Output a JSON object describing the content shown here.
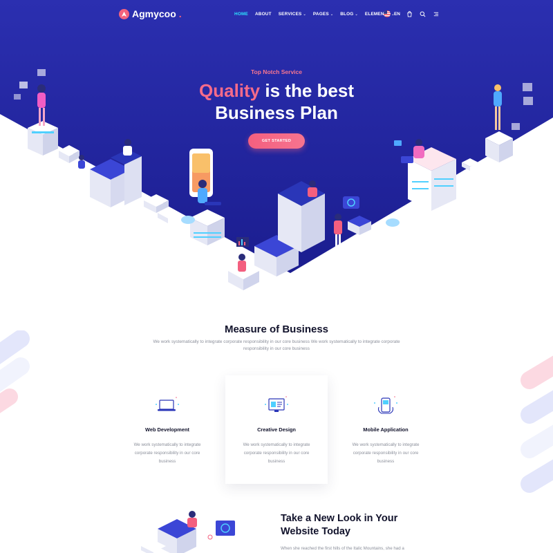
{
  "brand": {
    "name": "Agmycoo",
    "dot": ".",
    "accent": "#f4637e"
  },
  "nav": {
    "items": [
      {
        "label": "HOME",
        "active": true,
        "caret": false
      },
      {
        "label": "ABOUT",
        "active": false,
        "caret": false
      },
      {
        "label": "SERVICES",
        "active": false,
        "caret": true
      },
      {
        "label": "PAGES",
        "active": false,
        "caret": true
      },
      {
        "label": "BLOG",
        "active": false,
        "caret": true
      },
      {
        "label": "ELEMENTS",
        "active": false,
        "caret": true
      }
    ],
    "language": "EN",
    "icons": [
      "us-flag-icon",
      "cart-icon",
      "search-icon",
      "menu-icon"
    ]
  },
  "hero": {
    "eyebrow": "Top Notch Service",
    "title_accent": "Quality",
    "title_rest": " is the best",
    "title_line2": "Business Plan",
    "cta": "GET STARTED",
    "colors": {
      "bg_top": "#2b2fb0",
      "bg_bottom": "#1a1c8a",
      "accent": "#f56b8a"
    }
  },
  "services": {
    "title": "Measure of Business",
    "description": "We work systematically to integrate corporate responsibility in our core business We work systematically to integrate corporate responsibility in our core business",
    "cards": [
      {
        "title": "Web Development",
        "text": "We work systematically to integrate corporate responsibility in our core business",
        "icon": "laptop-icon",
        "featured": false
      },
      {
        "title": "Creative Design",
        "text": "We work systematically to integrate corporate responsibility in our core business",
        "icon": "design-monitor-icon",
        "featured": true
      },
      {
        "title": "Mobile Application",
        "text": "We work systematically to integrate corporate responsibility in our core business",
        "icon": "mobile-app-icon",
        "featured": false
      }
    ]
  },
  "feature": {
    "title_line1": "Take a New Look in Your",
    "title_line2": "Website Today",
    "text": "When she reached the first hills of the Italic Mountains, she had a"
  }
}
